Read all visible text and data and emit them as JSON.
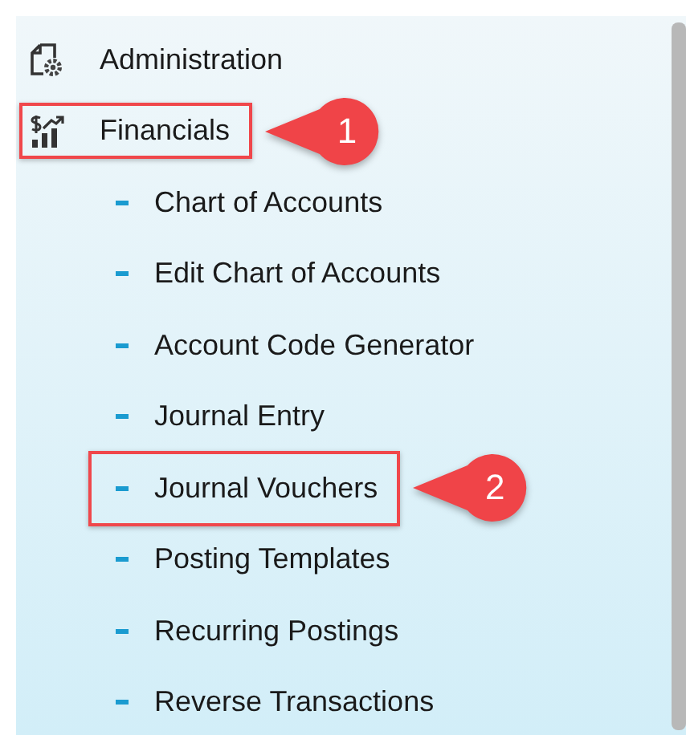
{
  "menu": [
    {
      "label": "Administration",
      "kind": "section",
      "highlighted": false
    },
    {
      "label": "Financials",
      "kind": "section",
      "highlighted": true,
      "callout": "1",
      "children": [
        {
          "label": "Chart of Accounts",
          "kind": "link",
          "highlighted": false
        },
        {
          "label": "Edit Chart of Accounts",
          "kind": "link",
          "highlighted": false
        },
        {
          "label": "Account Code Generator",
          "kind": "link",
          "highlighted": false
        },
        {
          "label": "Journal Entry",
          "kind": "link",
          "highlighted": false
        },
        {
          "label": "Journal Vouchers",
          "kind": "link",
          "highlighted": true,
          "callout": "2"
        },
        {
          "label": "Posting Templates",
          "kind": "link",
          "highlighted": false
        },
        {
          "label": "Recurring Postings",
          "kind": "link",
          "highlighted": false
        },
        {
          "label": "Reverse Transactions",
          "kind": "link",
          "highlighted": false
        }
      ]
    }
  ]
}
